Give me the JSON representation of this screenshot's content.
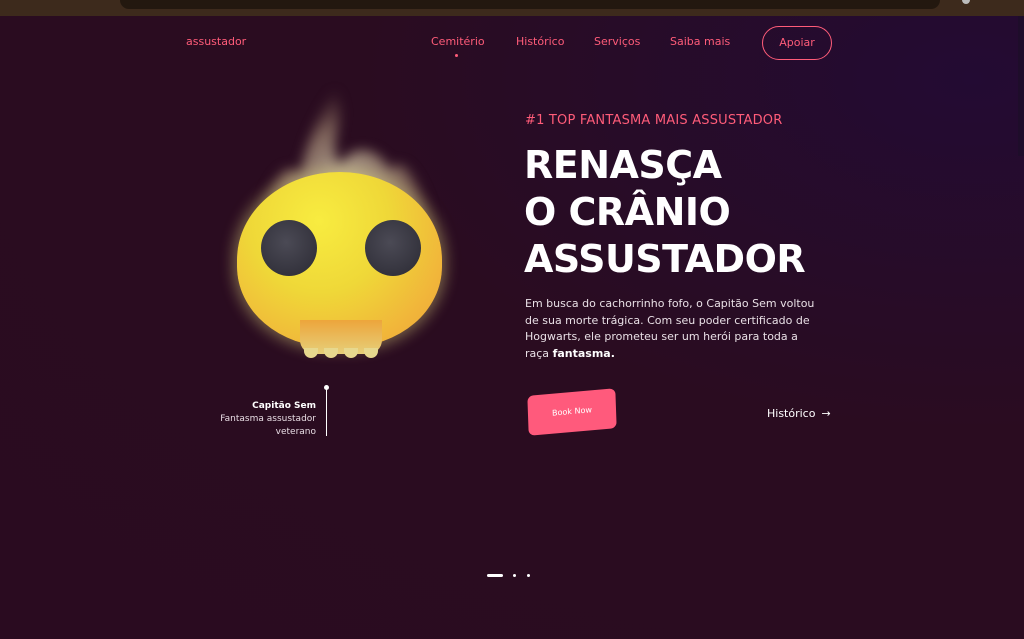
{
  "brand": "assustador",
  "nav": {
    "items": [
      {
        "label": "Cemitério",
        "active": true
      },
      {
        "label": "Histórico",
        "active": false
      },
      {
        "label": "Serviços",
        "active": false
      },
      {
        "label": "Saiba mais",
        "active": false
      }
    ],
    "cta": "Apoiar"
  },
  "hero": {
    "eyebrow": "#1 TOP FANTASMA MAIS ASSUSTADOR",
    "title_lines": [
      "RENASÇA",
      "O CRÂNIO",
      "ASSUSTADOR"
    ],
    "description_prefix": "Em busca do cachorrinho fofo, o Capitão Sem voltou de sua morte trágica. Com seu poder certificado de Hogwarts, ele prometeu ser um herói para toda a raça ",
    "description_bold": "fantasma.",
    "primary_button": "Book Now",
    "secondary_link": "Histórico",
    "secondary_link_icon": "arrow-right-icon"
  },
  "character": {
    "name": "Capitão Sem",
    "subtitle_line1": "Fantasma assustador",
    "subtitle_line2": "veterano"
  },
  "carousel": {
    "slides": 3,
    "active": 1
  },
  "colors": {
    "accent": "#ff5c79",
    "background": "#2a0c20",
    "text": "#ffffff"
  }
}
